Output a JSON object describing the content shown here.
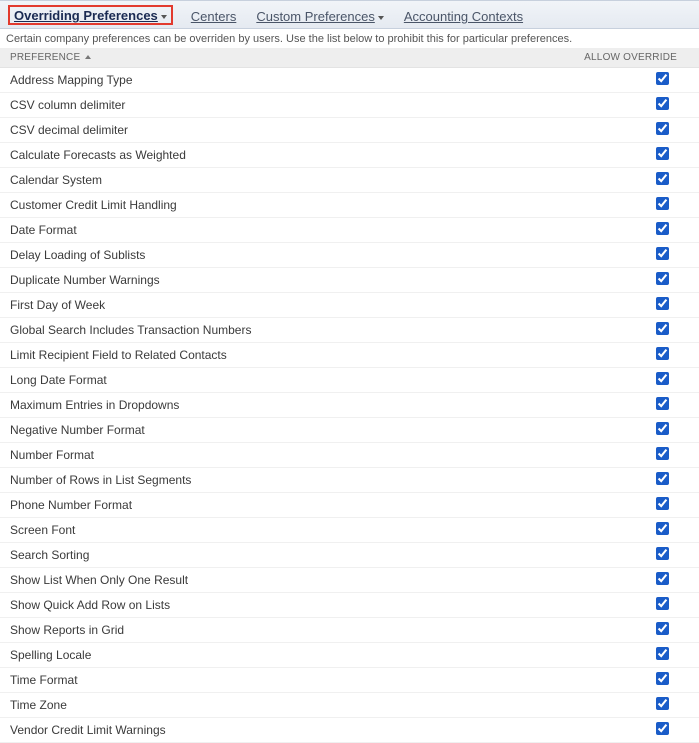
{
  "tabs": [
    {
      "label": "Overriding Preferences",
      "hasWedge": true,
      "active": true
    },
    {
      "label": "Centers",
      "hasWedge": false,
      "active": false
    },
    {
      "label": "Custom Preferences",
      "hasWedge": true,
      "active": false
    },
    {
      "label": "Accounting Contexts",
      "hasWedge": false,
      "active": false
    }
  ],
  "help_text": "Certain company preferences can be overriden by users. Use the list below to prohibit this for particular preferences.",
  "columns": {
    "preference": "PREFERENCE",
    "allow_override": "ALLOW OVERRIDE"
  },
  "sort_column": "preference",
  "preferences": [
    {
      "label": "Address Mapping Type",
      "allow": true
    },
    {
      "label": "CSV column delimiter",
      "allow": true
    },
    {
      "label": "CSV decimal delimiter",
      "allow": true
    },
    {
      "label": "Calculate Forecasts as Weighted",
      "allow": true
    },
    {
      "label": "Calendar System",
      "allow": true
    },
    {
      "label": "Customer Credit Limit Handling",
      "allow": true
    },
    {
      "label": "Date Format",
      "allow": true
    },
    {
      "label": "Delay Loading of Sublists",
      "allow": true
    },
    {
      "label": "Duplicate Number Warnings",
      "allow": true
    },
    {
      "label": "First Day of Week",
      "allow": true
    },
    {
      "label": "Global Search Includes Transaction Numbers",
      "allow": true
    },
    {
      "label": "Limit Recipient Field to Related Contacts",
      "allow": true
    },
    {
      "label": "Long Date Format",
      "allow": true
    },
    {
      "label": "Maximum Entries in Dropdowns",
      "allow": true
    },
    {
      "label": "Negative Number Format",
      "allow": true
    },
    {
      "label": "Number Format",
      "allow": true
    },
    {
      "label": "Number of Rows in List Segments",
      "allow": true
    },
    {
      "label": "Phone Number Format",
      "allow": true
    },
    {
      "label": "Screen Font",
      "allow": true
    },
    {
      "label": "Search Sorting",
      "allow": true
    },
    {
      "label": "Show List When Only One Result",
      "allow": true
    },
    {
      "label": "Show Quick Add Row on Lists",
      "allow": true
    },
    {
      "label": "Show Reports in Grid",
      "allow": true
    },
    {
      "label": "Spelling Locale",
      "allow": true
    },
    {
      "label": "Time Format",
      "allow": true
    },
    {
      "label": "Time Zone",
      "allow": true
    },
    {
      "label": "Vendor Credit Limit Warnings",
      "allow": true
    }
  ]
}
